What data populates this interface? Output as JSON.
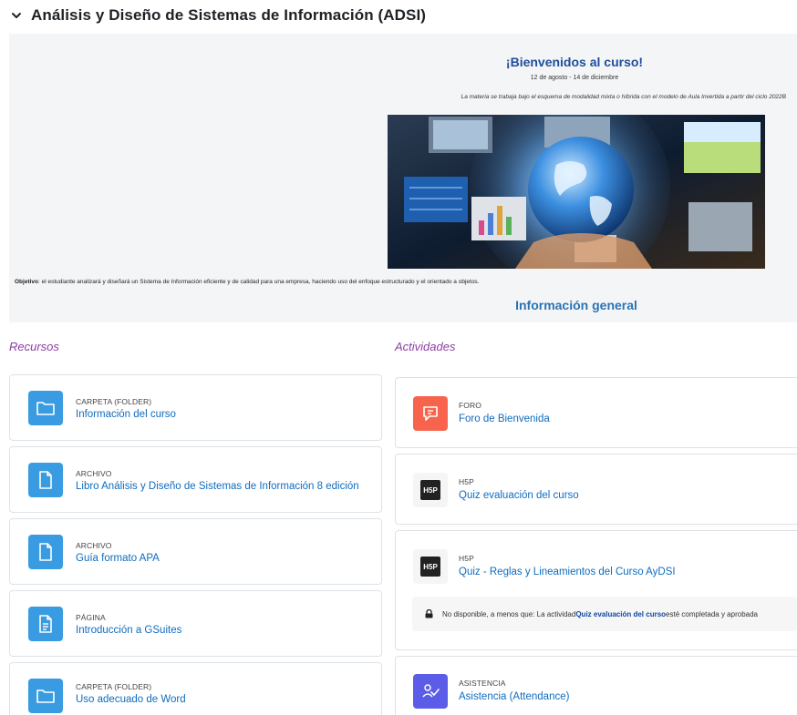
{
  "section": {
    "title": "Análisis y Diseño de Sistemas de Información (ADSI)",
    "toggle_icon": "chevron-down-icon"
  },
  "summary": {
    "welcome": "¡Bienvenidos al curso!",
    "dates": "12 de agosto - 14 de diciembre",
    "modality": "La materia se trabaja bajo el esquema de modalidad mixta o híbrida con el modelo de Aula Invertida a partir del ciclo 2022B",
    "objective_label": "Objetivo",
    "objective_text": ": el estudiante analizará y diseñará un Sistema de Información eficiente y de calidad para una empresa, haciendo uso del enfoque estructurado y el orientado a objetos.",
    "info_general": "Información general"
  },
  "recursos": {
    "title": "Recursos",
    "items": [
      {
        "type": "CARPETA (FOLDER)",
        "name": "Información del curso",
        "icon": "folder-icon"
      },
      {
        "type": "ARCHIVO",
        "name": "Libro Análisis y Diseño de Sistemas de Información 8 edición",
        "icon": "file-icon"
      },
      {
        "type": "ARCHIVO",
        "name": "Guía formato APA",
        "icon": "file-icon"
      },
      {
        "type": "PÁGINA",
        "name": "Introducción a GSuites",
        "icon": "page-icon"
      },
      {
        "type": "CARPETA (FOLDER)",
        "name": "Uso adecuado de Word",
        "icon": "folder-icon"
      }
    ]
  },
  "actividades": {
    "title": "Actividades",
    "items": [
      {
        "type": "FORO",
        "name": "Foro de Bienvenida",
        "icon": "forum-icon"
      },
      {
        "type": "H5P",
        "name": "Quiz evaluación del curso",
        "icon": "h5p-icon",
        "badge": "H5P"
      },
      {
        "type": "H5P",
        "name": "Quiz - Reglas y Lineamientos del Curso AyDSI",
        "icon": "h5p-icon",
        "badge": "H5P"
      },
      {
        "type": "ASISTENCIA",
        "name": "Asistencia (Attendance)",
        "icon": "attendance-icon"
      }
    ],
    "restriction": {
      "prefix": "No disponible, a menos que: La actividad ",
      "link": "Quiz evaluación del curso",
      "suffix": " esté completada y aprobada"
    }
  },
  "colors": {
    "accent": "#0f6cbf",
    "section_title": "#8b3fa3",
    "folder_icon": "#399be2",
    "forum_icon": "#f7634d",
    "attendance_icon": "#5b5de8"
  }
}
